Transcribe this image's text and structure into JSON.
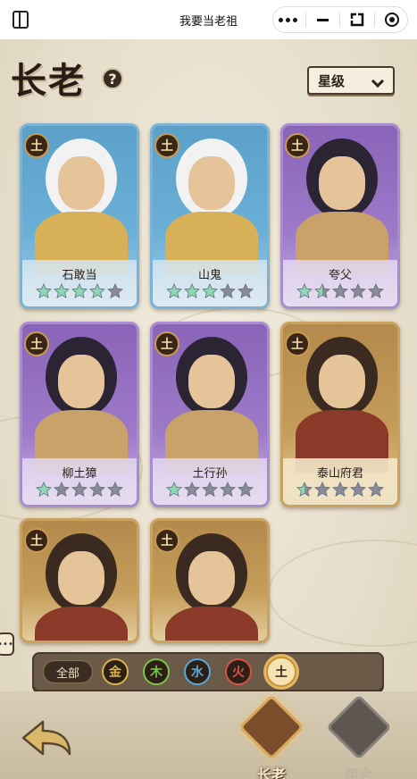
{
  "topbar": {
    "title": "我要当老祖",
    "sidebar_icon": "sidebar-toggle-icon",
    "capsule": [
      "more-dots-icon",
      "minimize-icon",
      "restore-icon",
      "close-target-icon"
    ]
  },
  "header": {
    "title": "长老",
    "help_label": "?",
    "sort_select": "星级"
  },
  "cards": [
    {
      "name": "石敢当",
      "element": "土",
      "stars": 4,
      "max_stars": 5,
      "frame": "water"
    },
    {
      "name": "山鬼",
      "element": "土",
      "stars": 3,
      "max_stars": 5,
      "frame": "water"
    },
    {
      "name": "夸父",
      "element": "土",
      "stars": 1.5,
      "max_stars": 5,
      "frame": "purple"
    },
    {
      "name": "柳土獐",
      "element": "土",
      "stars": 1,
      "max_stars": 5,
      "frame": "purple"
    },
    {
      "name": "土行孙",
      "element": "土",
      "stars": 1,
      "max_stars": 5,
      "frame": "purple"
    },
    {
      "name": "泰山府君",
      "element": "土",
      "stars": 0.5,
      "max_stars": 5,
      "frame": "gold"
    },
    {
      "name": "",
      "element": "土",
      "stars": 0,
      "max_stars": 5,
      "frame": "gold"
    },
    {
      "name": "",
      "element": "土",
      "stars": 0,
      "max_stars": 5,
      "frame": "gold"
    }
  ],
  "filters": {
    "all_label": "全部",
    "elements": [
      {
        "label": "金",
        "color": "#d9b24a"
      },
      {
        "label": "木",
        "color": "#7cc24a"
      },
      {
        "label": "水",
        "color": "#58a9d9"
      },
      {
        "label": "火",
        "color": "#d9524a"
      },
      {
        "label": "土",
        "color": "#c8923a",
        "active": true
      }
    ]
  },
  "nav": {
    "back_icon": "back-arrow-icon",
    "items": [
      {
        "label": "长老",
        "active": true
      },
      {
        "label": "组合",
        "active": false
      }
    ]
  },
  "colors": {
    "star_filled": "#8fd6b4",
    "star_empty": "#8a8a98",
    "accent_gold": "#c79a52"
  }
}
